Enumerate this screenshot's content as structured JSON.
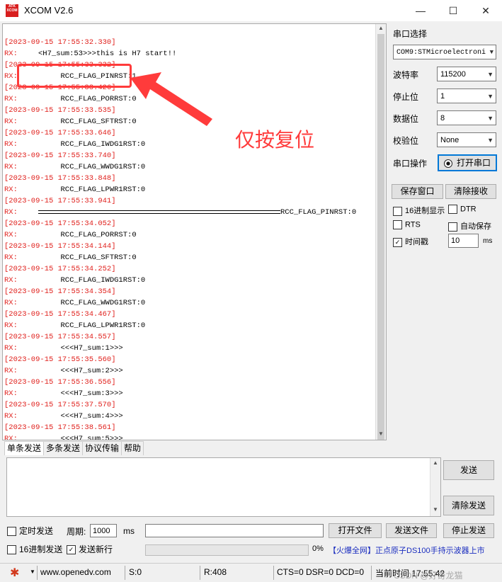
{
  "window": {
    "title": "XCOM V2.6",
    "logo_text": "ATK XCOM",
    "minimize": "—",
    "maximize": "☐",
    "close": "✕"
  },
  "receive": {
    "lines": [
      {
        "ts": "[2023-09-15 17:55:32.330]"
      },
      {
        "rx": "RX:",
        "text": "<H7_sum:53>>>this is H7 start!!"
      },
      {
        "ts": "[2023-09-15 17:55:33.332]"
      },
      {
        "rx": "RX:",
        "text": "     RCC_FLAG_PINRST:1"
      },
      {
        "ts": "[2023-09-15 17:55:33.426]"
      },
      {
        "rx": "RX:",
        "text": "     RCC_FLAG_PORRST:0"
      },
      {
        "ts": "[2023-09-15 17:55:33.535]"
      },
      {
        "rx": "RX:",
        "text": "     RCC_FLAG_SFTRST:0"
      },
      {
        "ts": "[2023-09-15 17:55:33.646]"
      },
      {
        "rx": "RX:",
        "text": "     RCC_FLAG_IWDG1RST:0"
      },
      {
        "ts": "[2023-09-15 17:55:33.740]"
      },
      {
        "rx": "RX:",
        "text": "     RCC_FLAG_WWDG1RST:0"
      },
      {
        "ts": "[2023-09-15 17:55:33.848]"
      },
      {
        "rx": "RX:",
        "text": "     RCC_FLAG_LPWR1RST:0"
      },
      {
        "ts": "[2023-09-15 17:55:33.941]"
      },
      {
        "rx": "RX:",
        "pin": "RCC_FLAG_PINRST:0"
      },
      {
        "ts": "[2023-09-15 17:55:34.052]"
      },
      {
        "rx": "RX:",
        "text": "     RCC_FLAG_PORRST:0"
      },
      {
        "ts": "[2023-09-15 17:55:34.144]"
      },
      {
        "rx": "RX:",
        "text": "     RCC_FLAG_SFTRST:0"
      },
      {
        "ts": "[2023-09-15 17:55:34.252]"
      },
      {
        "rx": "RX:",
        "text": "     RCC_FLAG_IWDG1RST:0"
      },
      {
        "ts": "[2023-09-15 17:55:34.354]"
      },
      {
        "rx": "RX:",
        "text": "     RCC_FLAG_WWDG1RST:0"
      },
      {
        "ts": "[2023-09-15 17:55:34.467]"
      },
      {
        "rx": "RX:",
        "text": "     RCC_FLAG_LPWR1RST:0"
      },
      {
        "ts": "[2023-09-15 17:55:34.557]"
      },
      {
        "rx": "RX:",
        "text": "     <<<H7_sum:1>>>"
      },
      {
        "ts": "[2023-09-15 17:55:35.560]"
      },
      {
        "rx": "RX:",
        "text": "     <<<H7_sum:2>>>"
      },
      {
        "ts": "[2023-09-15 17:55:36.556]"
      },
      {
        "rx": "RX:",
        "text": "     <<<H7_sum:3>>>"
      },
      {
        "ts": "[2023-09-15 17:55:37.570]"
      },
      {
        "rx": "RX:",
        "text": "     <<<H7_sum:4>>>"
      },
      {
        "ts": "[2023-09-15 17:55:38.561]"
      },
      {
        "rx": "RX:",
        "text": "     <<<H7_sum:5>>>"
      }
    ],
    "annotation": "仅按复位"
  },
  "settings": {
    "port_label": "串口选择",
    "port_value": "COM9:STMicroelectroni",
    "baud_label": "波特率",
    "baud_value": "115200",
    "stop_label": "停止位",
    "stop_value": "1",
    "data_label": "数据位",
    "data_value": "8",
    "parity_label": "校验位",
    "parity_value": "None",
    "op_label": "串口操作",
    "open_button": "打开串口",
    "save_window": "保存窗口",
    "clear_receive": "清除接收",
    "hex_display": "16进制显示",
    "dtr": "DTR",
    "rts": "RTS",
    "auto_save": "自动保存",
    "timestamp": "时间戳",
    "timestamp_ms": "10",
    "ms_unit": "ms"
  },
  "tabs": [
    "单条发送",
    "多条发送",
    "协议传输",
    "帮助"
  ],
  "send": {
    "send_button": "发送",
    "clear_send": "清除发送",
    "timed_send": "定时发送",
    "period_label": "周期:",
    "period_value": "1000",
    "period_unit": "ms",
    "open_file": "打开文件",
    "send_file": "发送文件",
    "stop_send": "停止发送",
    "hex_send": "16进制发送",
    "send_newline": "发送新行",
    "progress": "0%",
    "ad": "【火爆全网】正点原子DS100手持示波器上市"
  },
  "status": {
    "website": "www.openedv.com",
    "sent": "S:0",
    "received": "R:408",
    "lines": "CTS=0 DSR=0 DCD=0",
    "time": "当前时间 17:55:42",
    "watermark": "CSDN @好奇龙猫"
  }
}
